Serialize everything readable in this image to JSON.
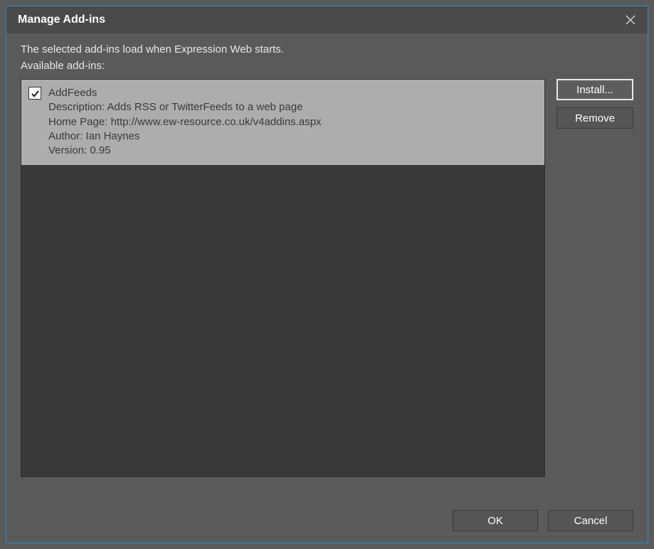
{
  "dialog": {
    "title": "Manage Add-ins",
    "intro_text": "The selected add-ins load when Expression Web starts.",
    "available_label": "Available add-ins:"
  },
  "addins": [
    {
      "checked": true,
      "name": "AddFeeds",
      "description_label": "Description:",
      "description": "Adds RSS or TwitterFeeds to a web page",
      "homepage_label": "Home Page:",
      "homepage": "http://www.ew-resource.co.uk/v4addins.aspx",
      "author_label": "Author:",
      "author": "Ian Haynes",
      "version_label": "Version:",
      "version": "0.95"
    }
  ],
  "buttons": {
    "install": "Install...",
    "remove": "Remove",
    "ok": "OK",
    "cancel": "Cancel"
  }
}
